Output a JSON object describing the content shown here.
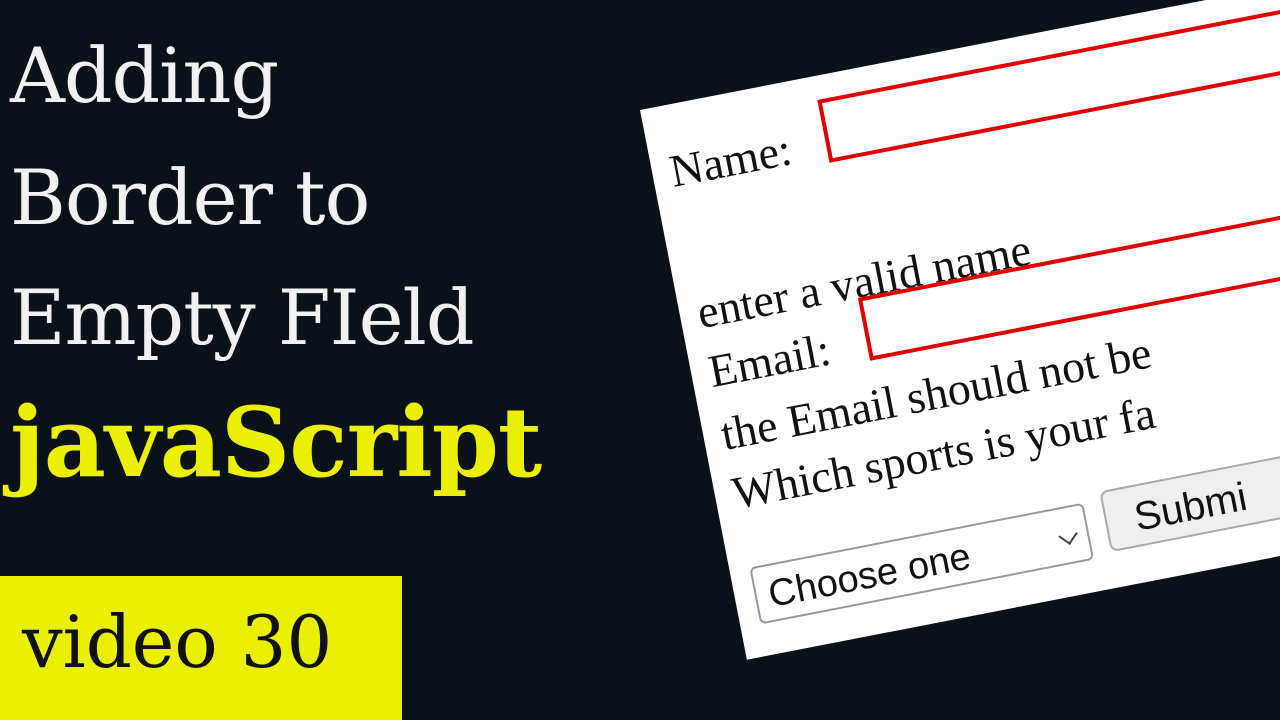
{
  "thumbnail": {
    "title_lines": [
      "Adding",
      "Border to",
      "Empty FIeld"
    ],
    "language": "javaScript",
    "video_label": "video 30"
  },
  "colors": {
    "background": "#0b1118",
    "accent_yellow": "#eaf000",
    "title_text": "#f1f1f1",
    "error_border": "#e00000"
  },
  "form": {
    "name_label": "Name:",
    "name_value": "",
    "name_error": "enter a valid name",
    "email_label": "Email:",
    "email_value": "",
    "email_error": "the Email should not be",
    "sports_question": "Which sports is your fa",
    "select": {
      "selected": "Choose one"
    },
    "submit_label": "Submi"
  }
}
